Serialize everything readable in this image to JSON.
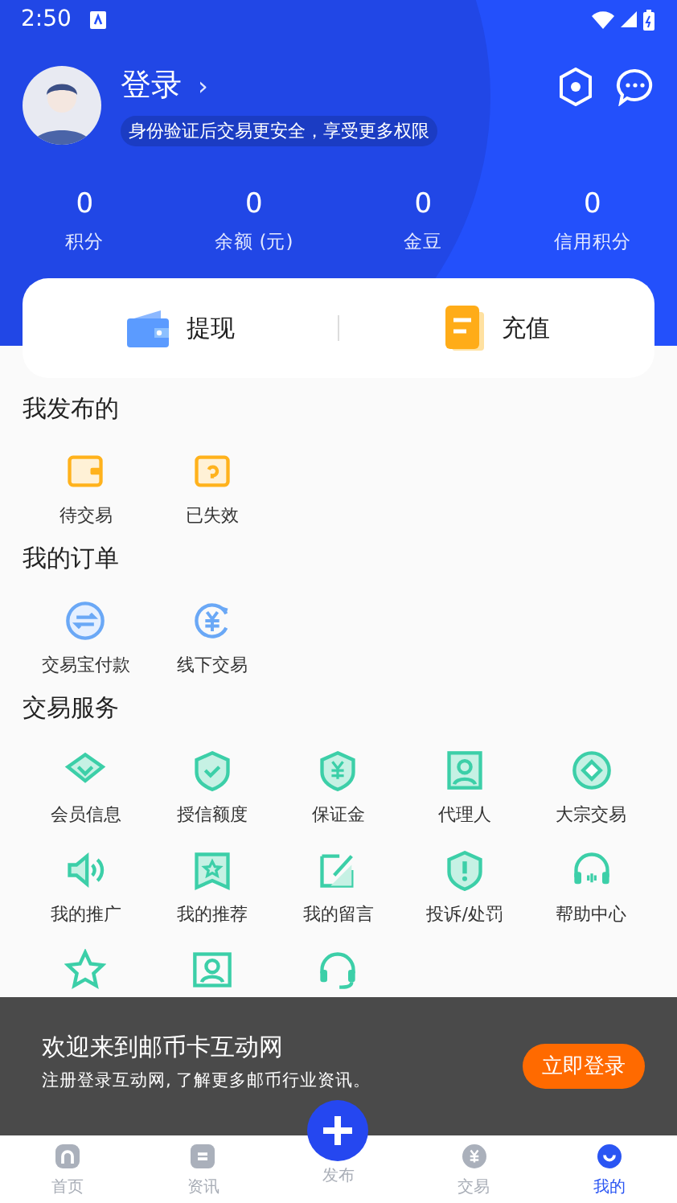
{
  "status_bar": {
    "time": "2:50"
  },
  "profile": {
    "name": "登录",
    "chevron": "›",
    "hint": "身份验证后交易更安全，享受更多权限"
  },
  "stats": [
    {
      "value": "0",
      "label": "积分"
    },
    {
      "value": "0",
      "label": "余额 (元)"
    },
    {
      "value": "0",
      "label": "金豆"
    },
    {
      "value": "0",
      "label": "信用积分"
    }
  ],
  "wallet_actions": [
    {
      "label": "提现"
    },
    {
      "label": "充值"
    }
  ],
  "sections": [
    {
      "title": "我发布的",
      "items": [
        {
          "label": "待交易"
        },
        {
          "label": "已失效"
        }
      ]
    },
    {
      "title": "我的订单",
      "items": [
        {
          "label": "交易宝付款"
        },
        {
          "label": "线下交易"
        }
      ]
    },
    {
      "title": "交易服务",
      "items": [
        {
          "label": "会员信息"
        },
        {
          "label": "授信额度"
        },
        {
          "label": "保证金"
        },
        {
          "label": "代理人"
        },
        {
          "label": "大宗交易"
        },
        {
          "label": "我的推广"
        },
        {
          "label": "我的推荐"
        },
        {
          "label": "我的留言"
        },
        {
          "label": "投诉/处罚"
        },
        {
          "label": "帮助中心"
        }
      ]
    }
  ],
  "banner": {
    "title": "欢迎来到邮币卡互动网",
    "subtitle": "注册登录互动网, 了解更多邮币行业资讯。",
    "button": "立即登录"
  },
  "bottom_nav": [
    {
      "label": "首页",
      "kind": "tab",
      "selected": false
    },
    {
      "label": "资讯",
      "kind": "tab",
      "selected": false
    },
    {
      "label": "发布",
      "kind": "publish",
      "selected": false
    },
    {
      "label": "交易",
      "kind": "tab",
      "selected": false
    },
    {
      "label": "我的",
      "kind": "tab",
      "selected": true
    }
  ]
}
